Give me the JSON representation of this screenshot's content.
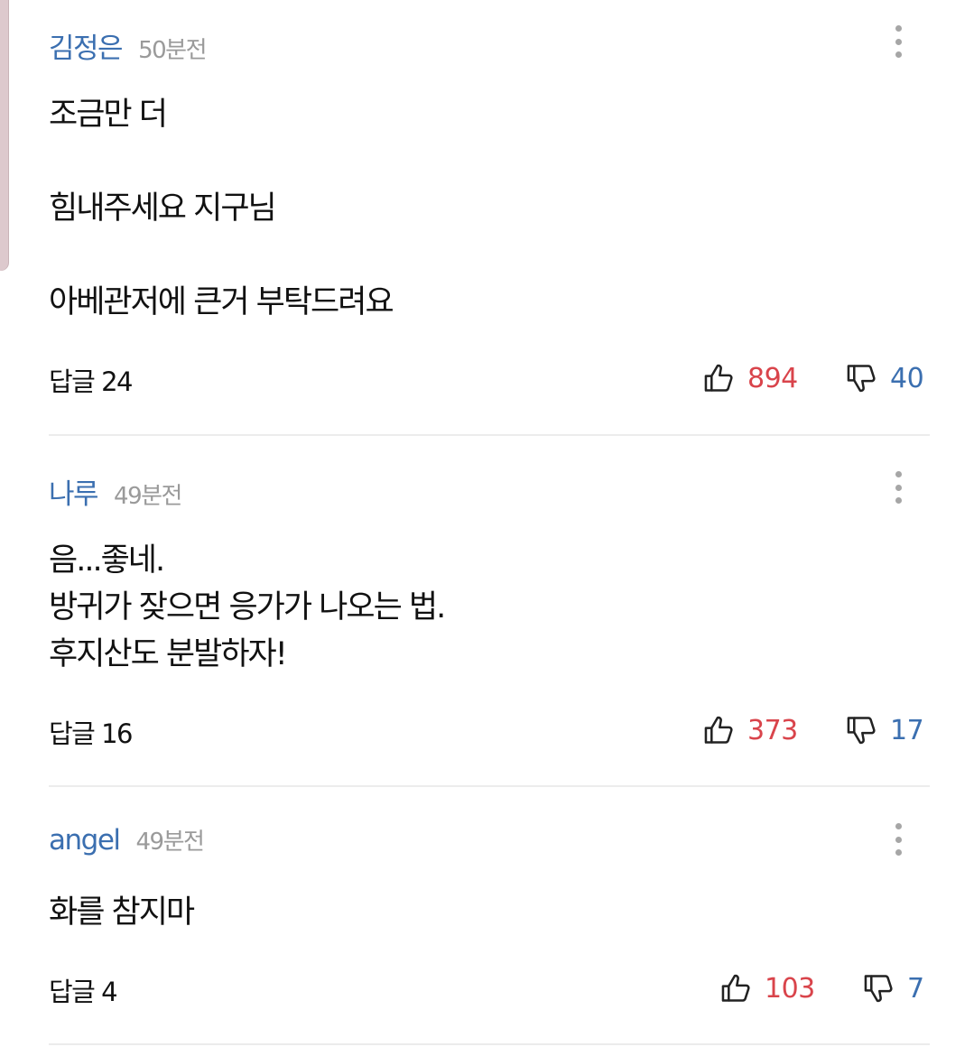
{
  "comments": [
    {
      "author": "김정은",
      "time": "50분전",
      "lines": [
        "조금만 더",
        "힘내주세요 지구님",
        "아베관저에 큰거 부탁드려요"
      ],
      "reply_label": "답글 24",
      "likes": "894",
      "dislikes": "40"
    },
    {
      "author": "나루",
      "time": "49분전",
      "lines": [
        "음...좋네.",
        "방귀가 잦으면 응가가 나오는 법.",
        "후지산도 분발하자!"
      ],
      "reply_label": "답글 16",
      "likes": "373",
      "dislikes": "17"
    },
    {
      "author": "angel",
      "time": "49분전",
      "lines": [
        "화를 참지마"
      ],
      "reply_label": "답글 4",
      "likes": "103",
      "dislikes": "7"
    }
  ],
  "icons": {
    "like": "thumbs-up-icon",
    "dislike": "thumbs-down-icon",
    "more": "more-vertical-icon"
  },
  "colors": {
    "author": "#3b6fb0",
    "like_count": "#d9444b",
    "dislike_count": "#3b6fb0",
    "time": "#9a9a9a"
  }
}
